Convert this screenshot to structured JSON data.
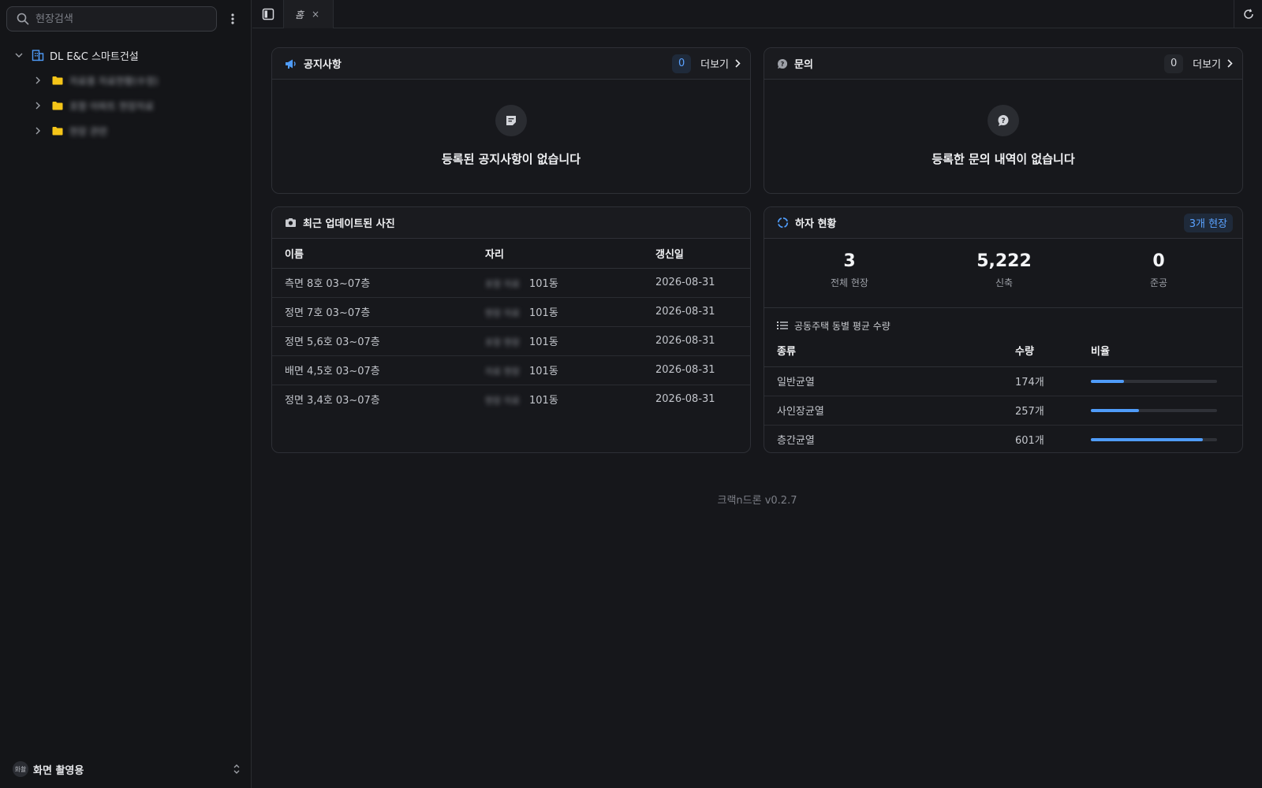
{
  "sidebar": {
    "search_placeholder": "현장검색",
    "org_name": "DL E&C 스마트건설",
    "folders": [
      {
        "label": "자료용 자료현황(수정)"
      },
      {
        "label": "포항 아파트 현장자료"
      },
      {
        "label": "현장 관련"
      }
    ],
    "profile": {
      "avatar_text": "화촬",
      "name": "화면 촬영용"
    }
  },
  "topbar": {
    "tab_label": "홈",
    "close_symbol": "×"
  },
  "notice": {
    "title": "공지사항",
    "count": "0",
    "more_label": "더보기",
    "empty_text": "등록된 공지사항이 없습니다"
  },
  "inquiry": {
    "title": "문의",
    "count": "0",
    "more_label": "더보기",
    "empty_text": "등록한 문의 내역이 없습니다"
  },
  "photos": {
    "title": "최근 업데이트된 사진",
    "columns": [
      "이름",
      "자리",
      "갱신일"
    ],
    "rows": [
      {
        "name": "측면 8호 03~07층",
        "place_blur": "포항 자료",
        "place": "101동",
        "date": "2026-08-31"
      },
      {
        "name": "정면 7호 03~07층",
        "place_blur": "현장 자료",
        "place": "101동",
        "date": "2026-08-31"
      },
      {
        "name": "정면 5,6호 03~07층",
        "place_blur": "포항 현장",
        "place": "101동",
        "date": "2026-08-31"
      },
      {
        "name": "배면 4,5호 03~07층",
        "place_blur": "자료 현장",
        "place": "101동",
        "date": "2026-08-31"
      },
      {
        "name": "정면 3,4호 03~07층",
        "place_blur": "현장 자료",
        "place": "101동",
        "date": "2026-08-31"
      }
    ]
  },
  "defects": {
    "title": "하자 현황",
    "badge": "3개 현장",
    "stats": [
      {
        "value": "3",
        "label": "전체 현장"
      },
      {
        "value": "5,222",
        "label": "신축"
      },
      {
        "value": "0",
        "label": "준공"
      }
    ],
    "sub_title": "공동주택 동별 평균 수량",
    "columns": [
      "종류",
      "수량",
      "비율"
    ],
    "rows": [
      {
        "type": "일반균열",
        "qty": "174개",
        "ratio": 0.26
      },
      {
        "type": "사인장균열",
        "qty": "257개",
        "ratio": 0.38
      },
      {
        "type": "층간균열",
        "qty": "601개",
        "ratio": 0.89
      }
    ]
  },
  "footer": {
    "version": "크랙n드론 v0.2.7"
  },
  "colors": {
    "accent": "#4f9cf9",
    "folder": "#f5c518"
  }
}
